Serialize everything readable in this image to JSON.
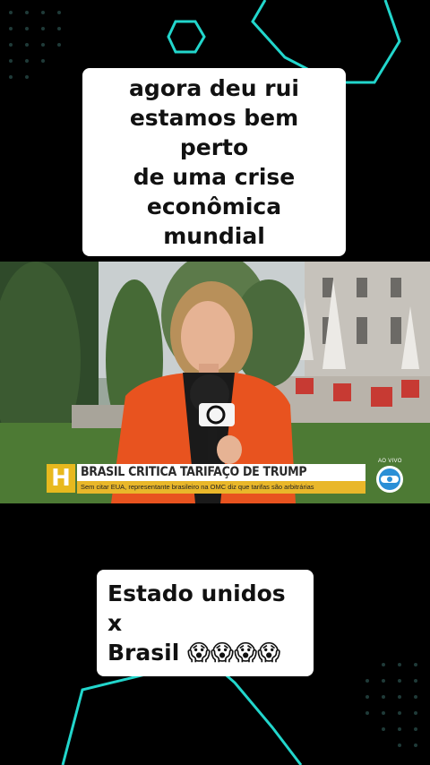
{
  "caption_top": {
    "lines": [
      "agora deu rui",
      "estamos bem perto",
      "de uma crise",
      "econômica mundial"
    ]
  },
  "caption_bottom": {
    "lines": [
      "Estado unidos x",
      "Brasil 😱😱😱😱"
    ]
  },
  "news": {
    "logo_letter": "H",
    "headline": "BRASIL CRITICA TARIFAÇO DE TRUMP",
    "subline": "Sem citar EUA, representante brasileiro na OMC diz que tarifas são arbitrárias",
    "live_label": "AO VIVO"
  },
  "colors": {
    "accent_line": "#20e0d0",
    "jacket": "#e8531f",
    "news_yellow": "#e9b72a"
  }
}
